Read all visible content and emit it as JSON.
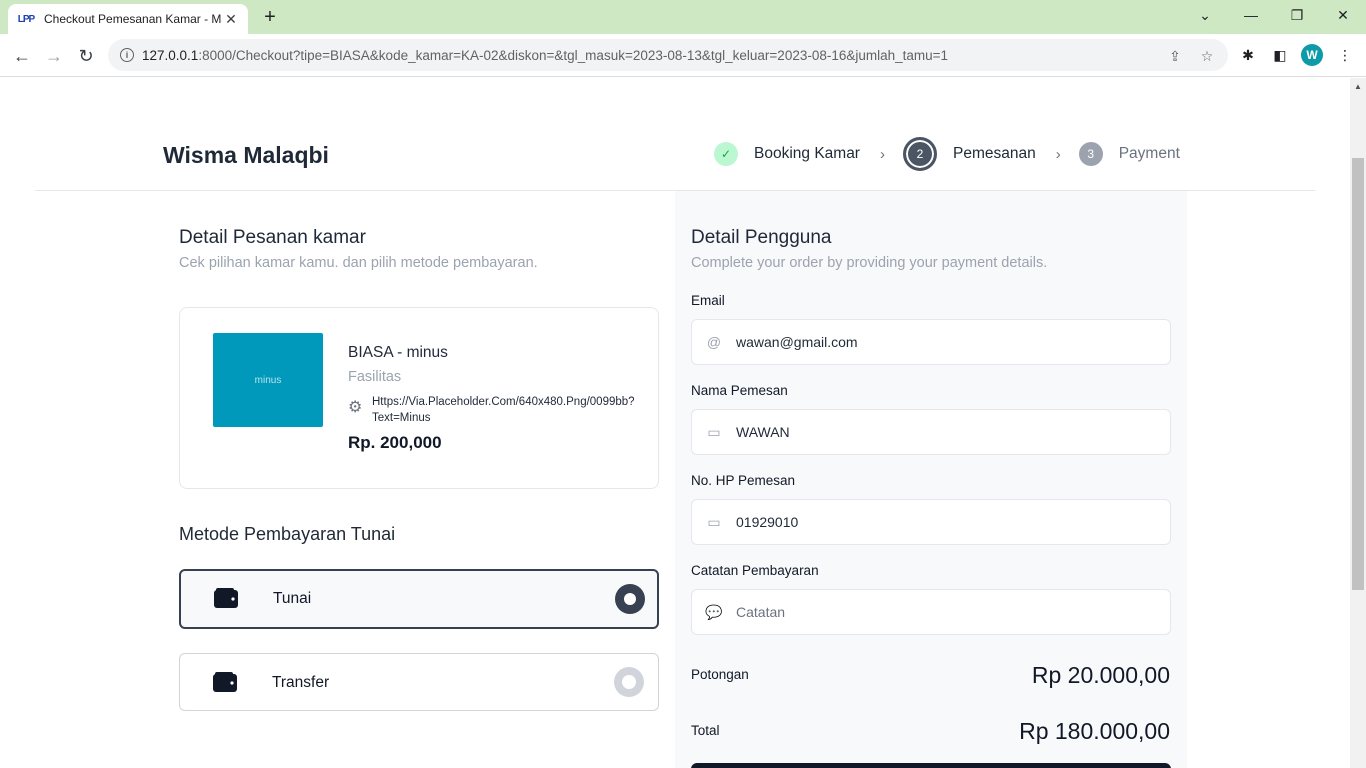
{
  "browser": {
    "tab_title": "Checkout Pemesanan Kamar - Malaqbi",
    "favicon_text": "LPP",
    "url_host": "127.0.0.1",
    "url_rest": ":8000/Checkout?tipe=BIASA&kode_kamar=KA-02&diskon=&tgl_masuk=2023-08-13&tgl_keluar=2023-08-16&jumlah_tamu=1",
    "avatar_initial": "W",
    "accent_color": "#cfe8c4"
  },
  "header": {
    "brand": "Wisma Malaqbi",
    "steps": [
      {
        "number": "✓",
        "label": "Booking Kamar",
        "state": "done"
      },
      {
        "number": "2",
        "label": "Pemesanan",
        "state": "active"
      },
      {
        "number": "3",
        "label": "Payment",
        "state": "upcoming"
      }
    ]
  },
  "order": {
    "title": "Detail Pesanan kamar",
    "subtitle": "Cek pilihan kamar kamu. dan pilih metode pembayaran.",
    "room": {
      "image_text": "minus",
      "image_color": "#0099bb",
      "name": "BIASA - minus",
      "facilities_label": "Fasilitas",
      "facilities_value": "Https://Via.Placeholder.Com/640x480.Png/0099bb?Text=Minus",
      "price": "Rp. 200,000"
    },
    "payment": {
      "title": "Metode Pembayaran Tunai",
      "options": [
        {
          "label": "Tunai",
          "selected": true
        },
        {
          "label": "Transfer",
          "selected": false
        }
      ]
    }
  },
  "user": {
    "title": "Detail Pengguna",
    "subtitle": "Complete your order by providing your payment details.",
    "fields": {
      "email": {
        "label": "Email",
        "value": "wawan@gmail.com"
      },
      "name": {
        "label": "Nama Pemesan",
        "value": "WAWAN"
      },
      "phone": {
        "label": "No. HP Pemesan",
        "value": "01929010"
      },
      "notes": {
        "label": "Catatan Pembayaran",
        "placeholder": "Catatan",
        "value": ""
      }
    },
    "summary": {
      "discount_label": "Potongan",
      "discount_value": "Rp 20.000,00",
      "total_label": "Total",
      "total_value": "Rp 180.000,00"
    }
  }
}
